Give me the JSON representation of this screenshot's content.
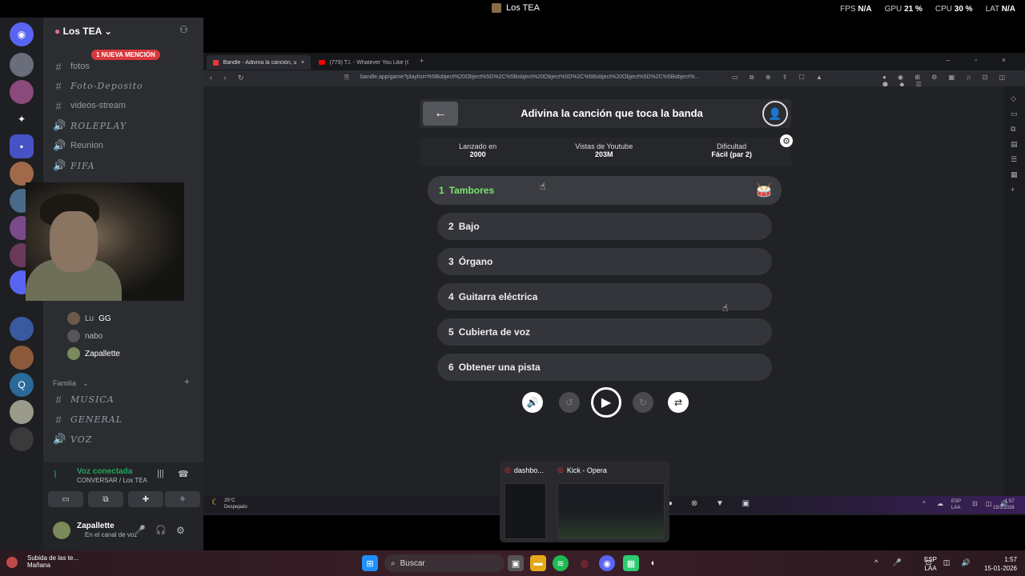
{
  "window": {
    "title": "Los TEA"
  },
  "overlay_stats": [
    {
      "label": "FPS",
      "value": "N/A"
    },
    {
      "label": "GPU",
      "value": "21 %"
    },
    {
      "label": "CPU",
      "value": "30 %"
    },
    {
      "label": "LAT",
      "value": "N/A"
    }
  ],
  "discord": {
    "server_name": "Los TEA",
    "mention_badge": "1 NUEVA MENCIÓN",
    "channels": [
      {
        "name": "fotos",
        "icon": "#"
      },
      {
        "name": "Foto-Deposito",
        "icon": "#"
      },
      {
        "name": "videos-stream",
        "icon": "#"
      },
      {
        "name": "ROLEPLAY",
        "icon": "🔊"
      },
      {
        "name": "Reunion",
        "icon": "🔊"
      },
      {
        "name": "FIFA",
        "icon": "🔊"
      }
    ],
    "voice_users": [
      {
        "name": "Lu",
        "tag": "GG"
      },
      {
        "name": "nabo"
      },
      {
        "name": "Zapallette"
      }
    ],
    "category": "Familia",
    "category_channels": [
      {
        "name": "MUSICA",
        "icon": "#"
      },
      {
        "name": "GENERAL",
        "icon": "#"
      },
      {
        "name": "VOZ",
        "icon": "🔊"
      }
    ],
    "voice_status": "Voz conectada",
    "voice_channel": "CONVERSAR / Los TEA",
    "user": {
      "name": "Zapallette",
      "status": "En el canal de voz"
    }
  },
  "browser": {
    "tabs": [
      {
        "label": "Bandle - Adivina la canción, un ..."
      },
      {
        "label": "(779) T.I. - Whatever You Like (Offici..."
      }
    ],
    "url": "bandle.app/game?playlist=%5Bobject%20Object%5D%2C%5Bobject%20Object%5D%2C%5Bobject%20Object%5D%2C%5Bobject%..."
  },
  "game": {
    "title": "Adivina la canción que toca la banda",
    "info": [
      {
        "label": "Lanzado en",
        "value": "2000"
      },
      {
        "label": "Vistas de Youtube",
        "value": "203M"
      },
      {
        "label": "Dificultad",
        "value": "Fácil (par 2)"
      }
    ],
    "hints": [
      {
        "num": "1",
        "label": "Tambores"
      },
      {
        "num": "2",
        "label": "Bajo"
      },
      {
        "num": "3",
        "label": "Órgano"
      },
      {
        "num": "4",
        "label": "Guitarra eléctrica"
      },
      {
        "num": "5",
        "label": "Cubierta de voz"
      },
      {
        "num": "6",
        "label": "Obtener una pista"
      }
    ]
  },
  "inner_taskbar": {
    "weather_temp": "25°C",
    "weather_text": "Despejado",
    "preview_1": "dashbo...",
    "preview_2": "Kick - Opera",
    "lang": "ESP\nLAA",
    "time": "1:57",
    "date": "15/1/2026"
  },
  "taskbar": {
    "notification_title": "Subida de las te...",
    "notification_sub": "Mañana",
    "search_placeholder": "Buscar",
    "lang_top": "ESP",
    "lang_bottom": "LAA",
    "time": "1:57",
    "date": "15-01-2026"
  }
}
